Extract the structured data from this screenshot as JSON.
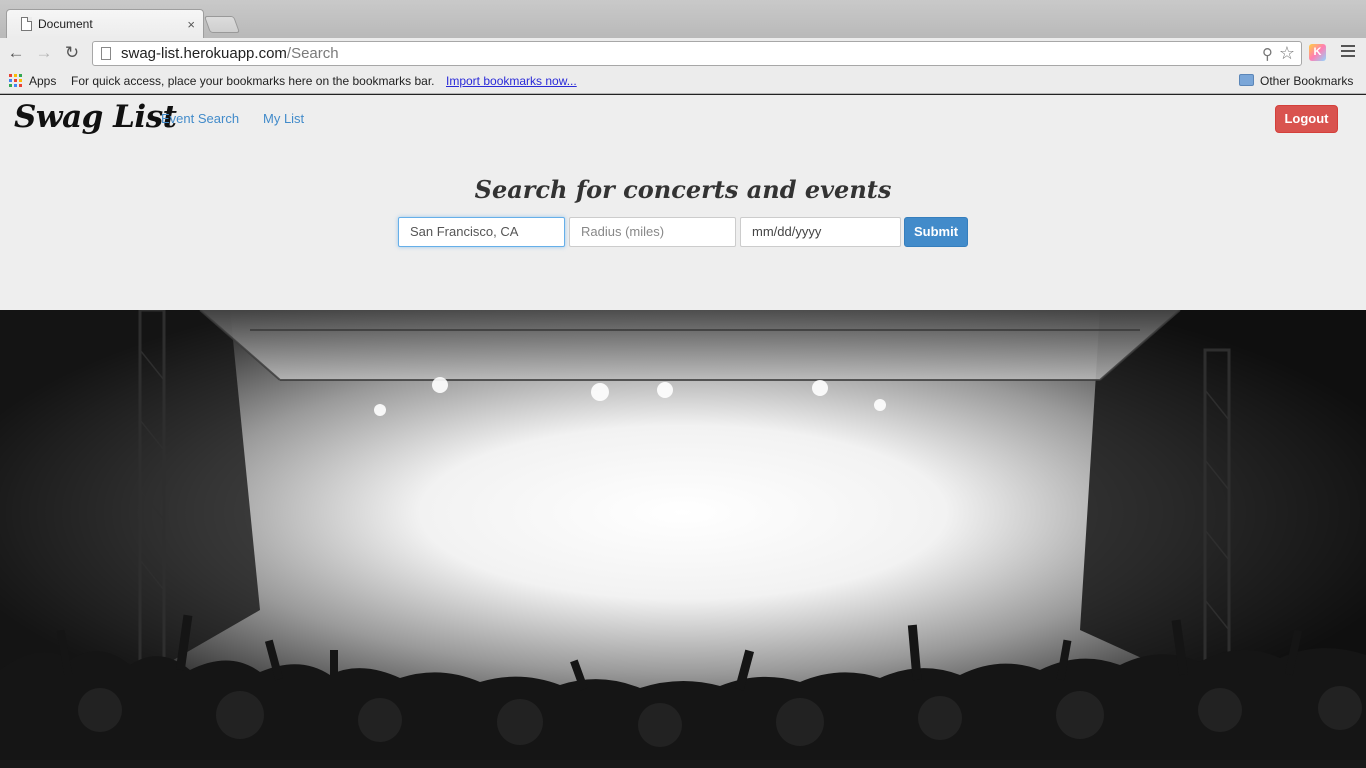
{
  "browser": {
    "tab_title": "Document",
    "tab_close": "×",
    "url_host": "swag-list.herokuapp.com",
    "url_path": "/Search",
    "bookmarks_bar": {
      "apps_label": "Apps",
      "hint": "For quick access, place your bookmarks here on the bookmarks bar.",
      "import_link": "Import bookmarks now...",
      "other_bookmarks": "Other Bookmarks"
    },
    "icons": [
      "document-icon",
      "back-icon",
      "forward-icon",
      "reload-icon",
      "page-icon",
      "zoom-icon",
      "star-icon",
      "extension-icon",
      "menu-icon",
      "apps-icon",
      "folder-icon"
    ],
    "ext_letter": "K"
  },
  "app": {
    "brand": "Swag List",
    "nav": {
      "event_search": "Event Search",
      "my_list": "My List"
    },
    "logout_label": "Logout",
    "search": {
      "title": "Search for concerts and events",
      "location_value": "San Francisco, CA",
      "radius_placeholder": "Radius (miles)",
      "date_placeholder": "mm/dd/yyyy",
      "submit_label": "Submit"
    },
    "colors": {
      "link": "#428bca",
      "submit": "#428bca",
      "logout": "#d9534f",
      "header_bg": "#eeeeee"
    },
    "hero_image": "concert-crowd-photo"
  }
}
